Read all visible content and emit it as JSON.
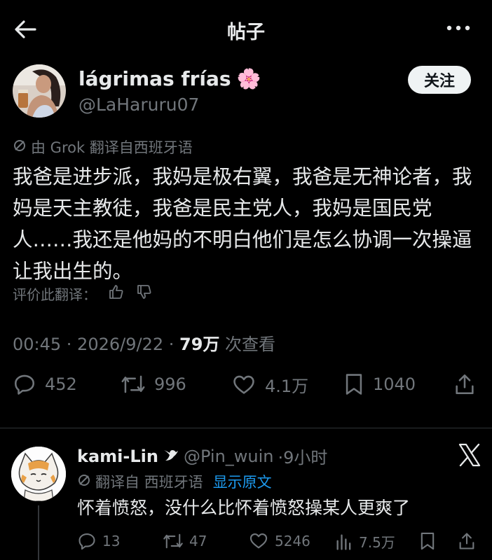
{
  "header": {
    "title": "帖子",
    "back_icon": "arrow-left-icon",
    "more_icon": "more-horizontal-icon"
  },
  "post": {
    "author": {
      "name": "lágrimas frías",
      "emoji": "🌸",
      "handle": "@LaHaruru07"
    },
    "follow_label": "关注",
    "translated_note": "由 Grok 翻译自西班牙语",
    "text": "我爸是进步派，我妈是极右翼，我爸是无神论者，我妈是天主教徒，我爸是民主党人，我妈是国民党人……我还是他妈的不明白他们是怎么协调一次操逼让我出生的。",
    "rate_label": "评价此翻译：",
    "time": "00:45 · 2026/9/22 · ",
    "views": "79万",
    "views_suffix": " 次查看",
    "stats": {
      "replies": "452",
      "reposts": "996",
      "likes": "4.1万",
      "bookmarks": "1040"
    }
  },
  "reply": {
    "name": "kami-Lin",
    "handle": "@Pin_wuin",
    "time": "·9小时",
    "translated_note": "翻译自 西班牙语",
    "show_original": "显示原文",
    "text": "怀着愤怒，没什么比怀着愤怒操某人更爽了",
    "stats": {
      "replies": "13",
      "reposts": "47",
      "likes": "5246",
      "views": "7.5万"
    }
  },
  "colors": {
    "background": "#000000",
    "text": "#e7e9ea",
    "muted": "#71767b",
    "link": "#1d9bf0",
    "divider": "#2f3336"
  }
}
